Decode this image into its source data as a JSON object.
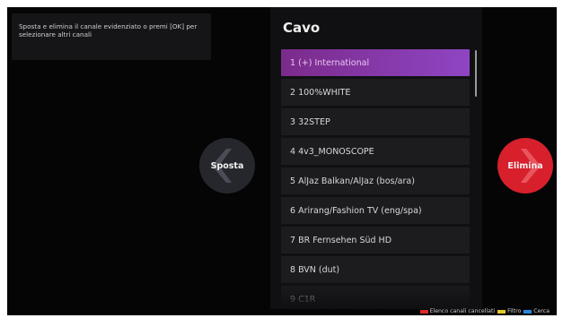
{
  "hint": {
    "text": "Sposta e elimina il canale evidenziato o premi [OK] per selezionare altri canali"
  },
  "panel": {
    "title": "Cavo",
    "channels": [
      {
        "label": "1 (+) International"
      },
      {
        "label": "2 100%WHITE"
      },
      {
        "label": "3 32STEP"
      },
      {
        "label": "4 4v3_MONOSCOPE"
      },
      {
        "label": "5 AlJaz Balkan/AlJaz (bos/ara)"
      },
      {
        "label": "6 Arirang/Fashion TV (eng/spa)"
      },
      {
        "label": "7 BR Fernsehen Süd HD"
      },
      {
        "label": "8 BVN (dut)"
      },
      {
        "label": "9 C1R"
      }
    ],
    "selected_index": 0
  },
  "buttons": {
    "move_label": "Sposta",
    "delete_label": "Elimina"
  },
  "legend": {
    "items": [
      {
        "label": "Elenco canali cancellati",
        "color": "#d82a2a"
      },
      {
        "label": "Filtro",
        "color": "#e5c72a"
      },
      {
        "label": "Cerca",
        "color": "#2a86d8"
      }
    ]
  },
  "colors": {
    "selected_row": "#8a3db0",
    "delete_button": "#d7202c",
    "move_button": "#25272d"
  }
}
